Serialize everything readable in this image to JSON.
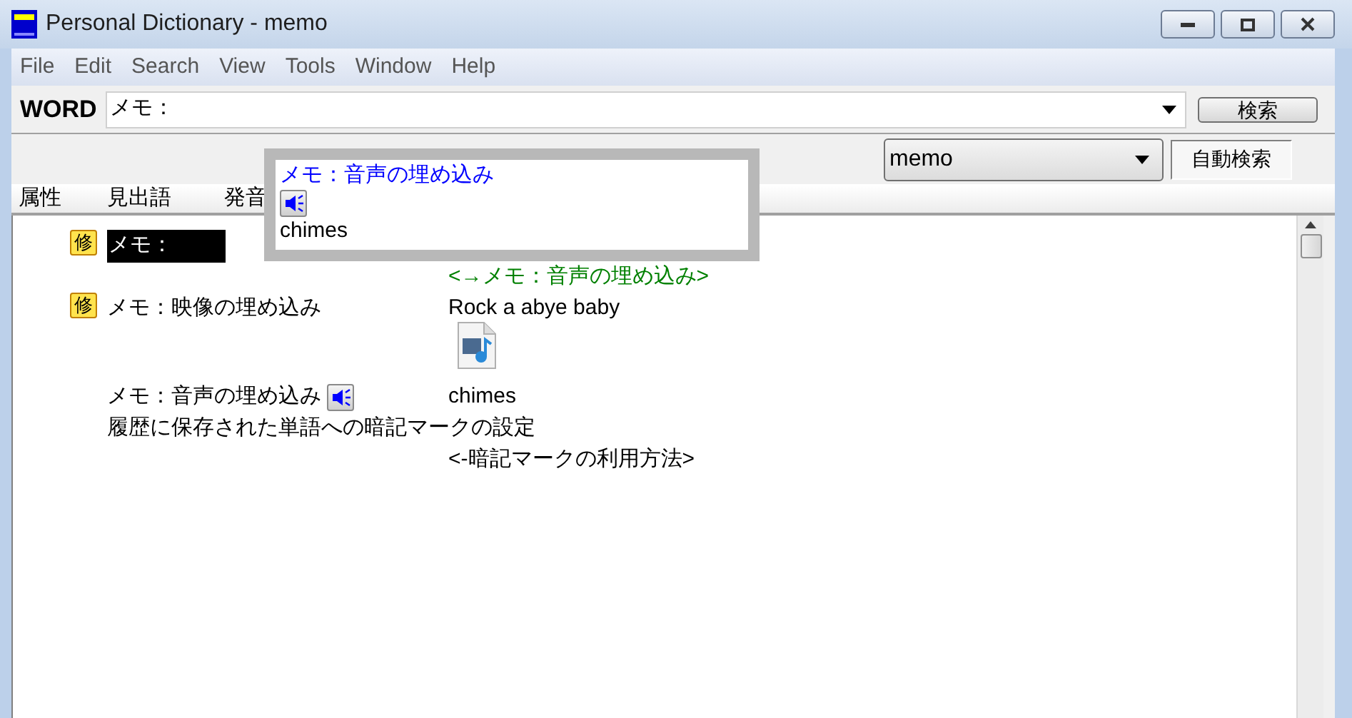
{
  "window": {
    "title": "Personal Dictionary - memo"
  },
  "menu": [
    "File",
    "Edit",
    "Search",
    "View",
    "Tools",
    "Window",
    "Help"
  ],
  "search": {
    "label": "WORD",
    "value": "メモ：",
    "button": "検索"
  },
  "toolbar": {
    "dictionary": "memo",
    "auto_search": {
      "label": "自動検索",
      "pressed": true
    }
  },
  "columns": [
    "属性",
    "見出語",
    "発音"
  ],
  "rows": [
    {
      "badge": "修",
      "headword": "メモ：",
      "selected": true
    },
    {
      "translation": {
        "kind": "link",
        "text": "<→メモ：音声の埋め込み>"
      }
    },
    {
      "badge": "修",
      "headword": "メモ：映像の埋め込み",
      "selected": false,
      "translation": {
        "kind": "text",
        "text": "Rock a abye baby"
      }
    },
    {
      "translation": {
        "kind": "media"
      }
    },
    {
      "headword": "メモ：音声の埋め込み",
      "sound": true,
      "selected": false,
      "translation": {
        "kind": "text",
        "text": "chimes"
      }
    },
    {
      "headword": "履歴に保存された単語への暗記マークの設定",
      "selected": false
    },
    {
      "translation": {
        "kind": "text",
        "text": "<-暗記マークの利用方法>"
      }
    }
  ],
  "popup": {
    "title": "メモ：音声の埋め込み",
    "sound": true,
    "caption": "chimes"
  }
}
